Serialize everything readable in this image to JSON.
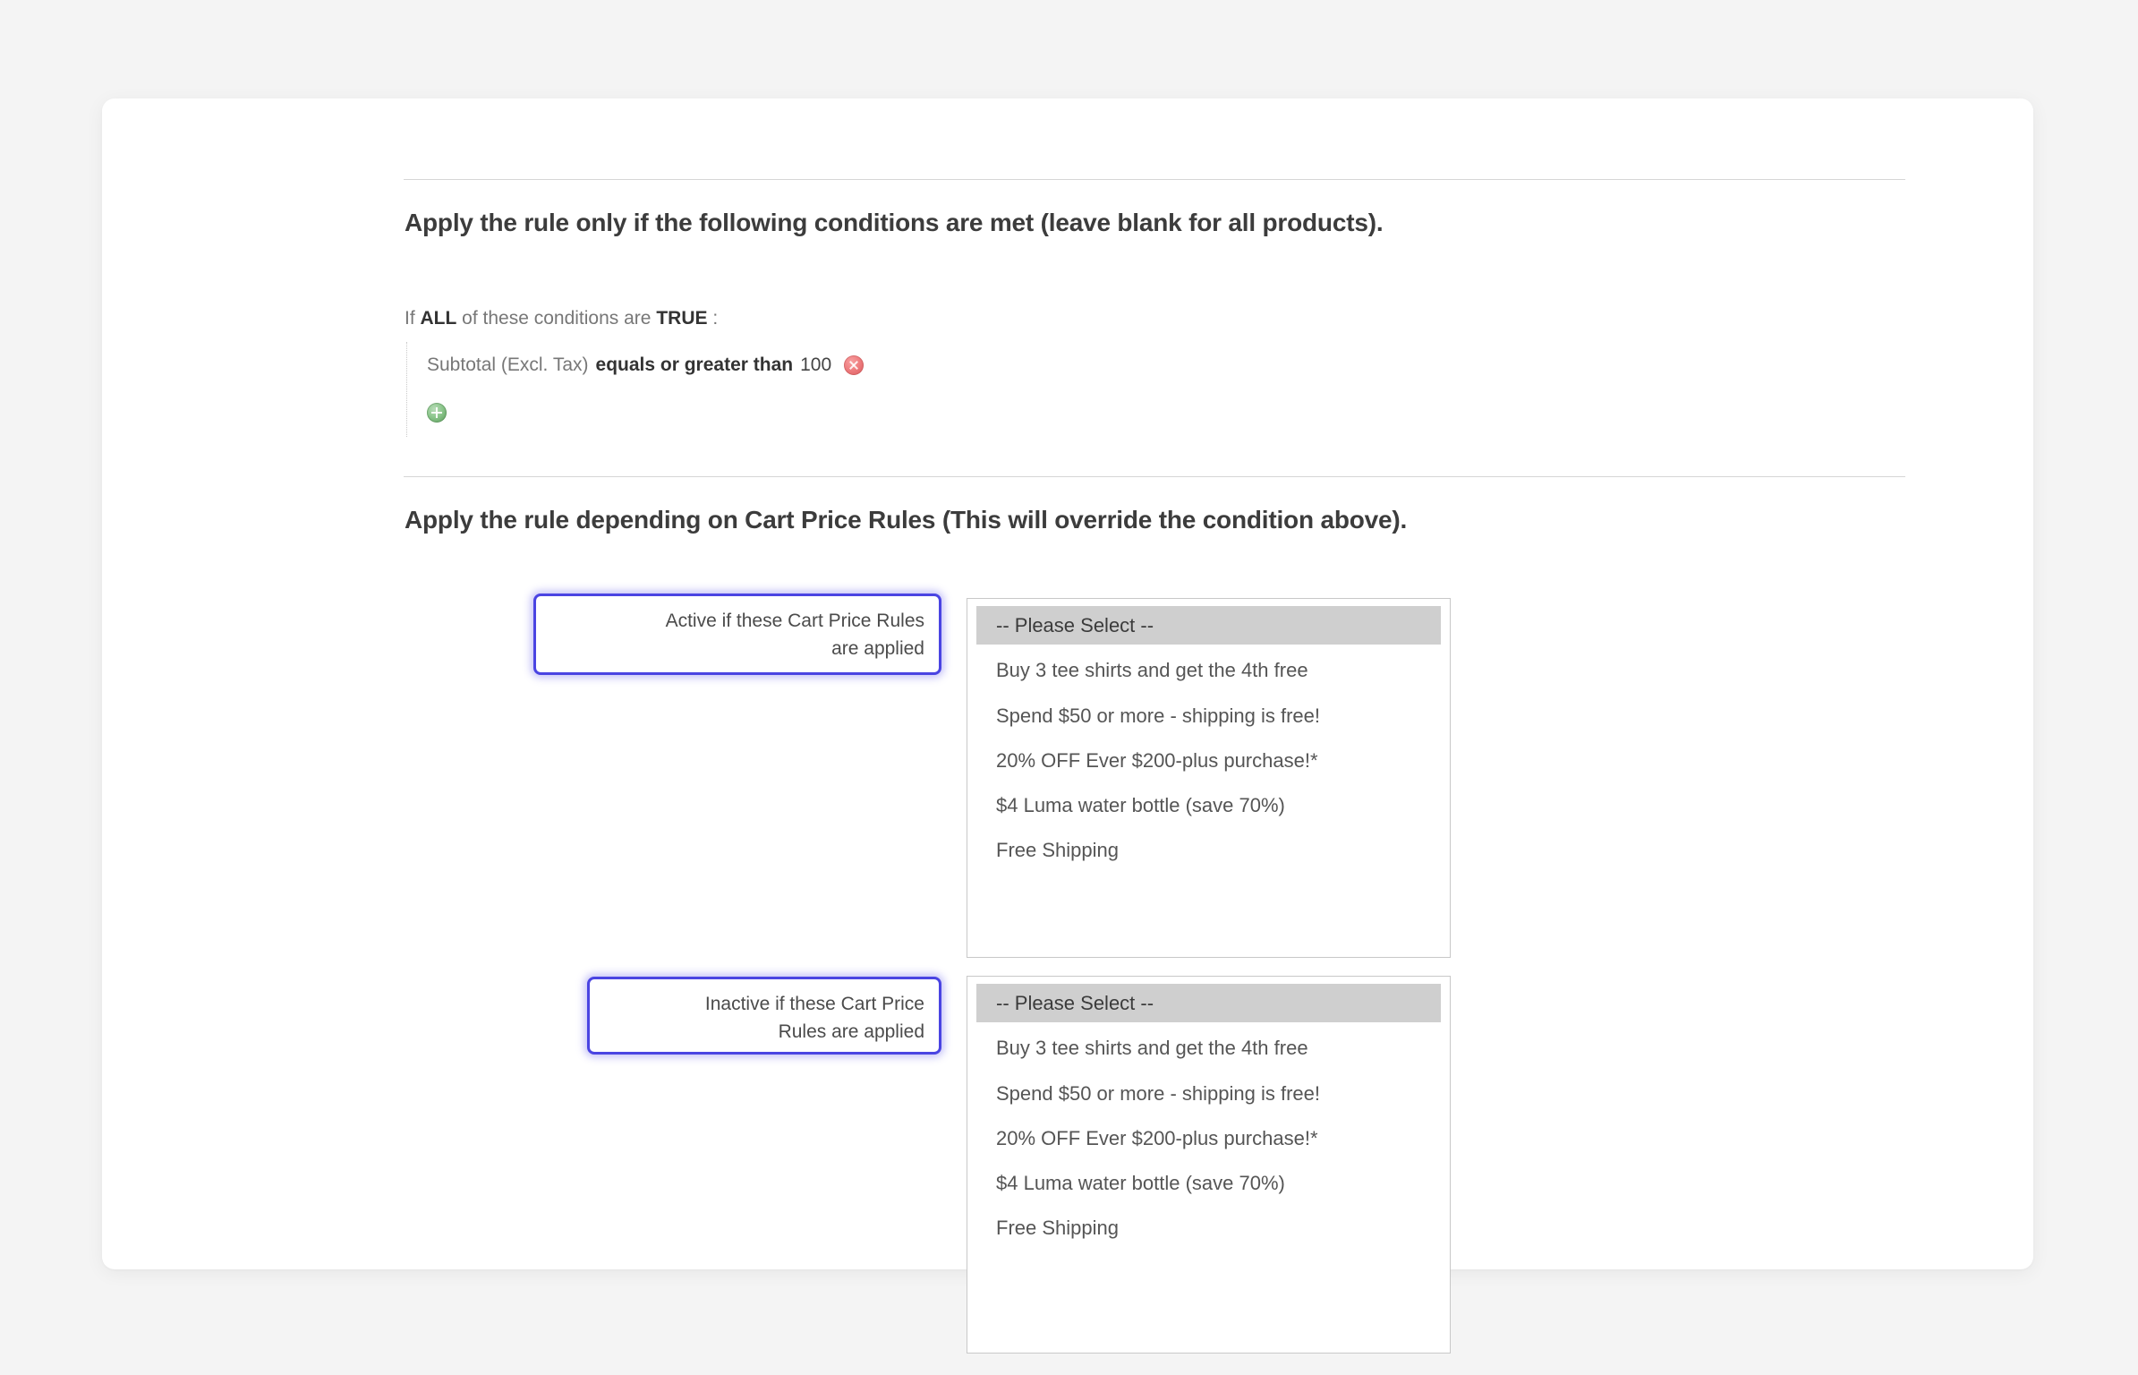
{
  "conditions_section": {
    "title": "Apply the rule only if the following conditions are met (leave blank for all products).",
    "root_prefix": "If ",
    "root_aggregator": "ALL",
    "root_middle": " of these conditions are ",
    "root_value": "TRUE",
    "root_suffix": " :",
    "rows": [
      {
        "attribute": "Subtotal (Excl. Tax)",
        "operator": "equals or greater than",
        "value": "100",
        "delete_icon": "delete-circle-icon"
      }
    ],
    "add_icon": "add-circle-icon"
  },
  "cart_rules_section": {
    "title": "Apply the rule depending on Cart Price Rules (This will override the condition above).",
    "highlight_color": "#4a44e2",
    "fields": [
      {
        "label": "Active if these Cart Price Rules are applied",
        "label_line1": "Active if these Cart Price Rules",
        "label_line2": "are applied",
        "options": [
          "-- Please Select --",
          "Buy 3 tee shirts and get the 4th free",
          "Spend $50 or more - shipping is free!",
          "20% OFF Ever $200-plus purchase!*",
          "$4 Luma water bottle (save 70%)",
          "Free Shipping"
        ],
        "selected": "-- Please Select --"
      },
      {
        "label": "Inactive if these Cart Price Rules are applied",
        "label_line1": "Inactive if these Cart Price",
        "label_line2": "Rules are applied",
        "options": [
          "-- Please Select --",
          "Buy 3 tee shirts and get the 4th free",
          "Spend $50 or more - shipping is free!",
          "20% OFF Ever $200-plus purchase!*",
          "$4 Luma water bottle (save 70%)",
          "Free Shipping"
        ],
        "selected": "-- Please Select --"
      }
    ]
  }
}
